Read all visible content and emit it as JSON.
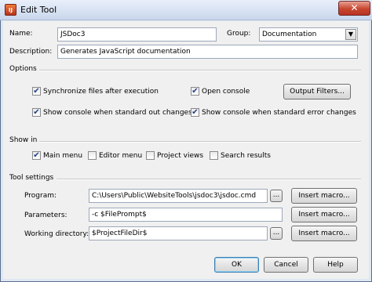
{
  "window": {
    "title": "Edit Tool",
    "close_glyph": "✕",
    "app_icon_text": "IJ"
  },
  "form": {
    "name_label": "Name:",
    "name_value": "JSDoc3",
    "group_label": "Group:",
    "group_value": "Documentation",
    "description_label": "Description:",
    "description_value": "Generates JavaScript documentation"
  },
  "options": {
    "section": "Options",
    "sync_label": "Synchronize files after execution",
    "open_console_label": "Open console",
    "output_filters_label": "Output Filters...",
    "show_stdout_label": "Show console when standard out changes",
    "show_stderr_label": "Show console when standard error changes",
    "check_glyph": "✔"
  },
  "show_in": {
    "section": "Show in",
    "main_menu": "Main menu",
    "editor_menu": "Editor menu",
    "project_views": "Project views",
    "search_results": "Search results"
  },
  "tool_settings": {
    "section": "Tool settings",
    "program_label": "Program:",
    "program_value": "C:\\Users\\Public\\WebsiteTools\\jsdoc3\\jsdoc.cmd",
    "parameters_label": "Parameters:",
    "parameters_value": "-c $FilePrompt$",
    "working_dir_label": "Working directory:",
    "working_dir_value": "$ProjectFileDir$",
    "browse_label": "...",
    "insert_macro_label": "Insert macro..."
  },
  "footer": {
    "ok": "OK",
    "cancel": "Cancel",
    "help": "Help"
  },
  "icons": {
    "dropdown": "chevron-down-icon",
    "check": "checkmark-icon",
    "app": "app-icon"
  }
}
